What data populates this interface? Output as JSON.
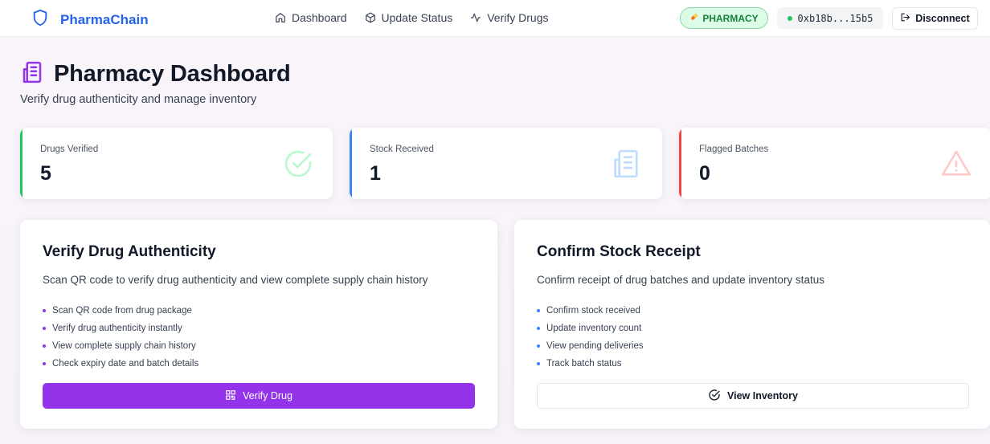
{
  "nav": {
    "brand": "PharmaChain",
    "links": [
      "Dashboard",
      "Update Status",
      "Verify Drugs"
    ],
    "role": "PHARMACY",
    "wallet": "0xb18b...15b5",
    "disconnect_label": "Disconnect"
  },
  "header": {
    "title": "Pharmacy Dashboard",
    "subtitle": "Verify drug authenticity and manage inventory"
  },
  "stats": [
    {
      "label": "Drugs Verified",
      "value": "5",
      "accent": "#22c55e"
    },
    {
      "label": "Stock Received",
      "value": "1",
      "accent": "#3b82f6"
    },
    {
      "label": "Flagged Batches",
      "value": "0",
      "accent": "#ef4444"
    }
  ],
  "verify_card": {
    "title": "Verify Drug Authenticity",
    "description": "Scan QR code to verify drug authenticity and view complete supply chain history",
    "items": [
      "Scan QR code from drug package",
      "Verify drug authenticity instantly",
      "View complete supply chain history",
      "Check expiry date and batch details"
    ],
    "button_label": "Verify Drug",
    "bullet_color": "#9333ea"
  },
  "stock_card": {
    "title": "Confirm Stock Receipt",
    "description": "Confirm receipt of drug batches and update inventory status",
    "items": [
      "Confirm stock received",
      "Update inventory count",
      "View pending deliveries",
      "Track batch status"
    ],
    "button_label": "View Inventory",
    "bullet_color": "#3b82f6"
  },
  "colors": {
    "brand": "#2563eb",
    "primary": "#9333ea",
    "success": "#22c55e",
    "info": "#3b82f6",
    "danger": "#ef4444"
  },
  "icons": {
    "brand": "shield-icon",
    "dashboard": "home-icon",
    "update_status": "package-icon",
    "verify_drugs": "activity-icon",
    "role": "pill-icon",
    "disconnect": "logout-icon",
    "title": "building-icon",
    "verified": "check-circle-icon",
    "stock": "building-icon",
    "flagged": "warning-icon",
    "verify_button": "qr-code-icon",
    "inventory_button": "check-circle-icon"
  }
}
